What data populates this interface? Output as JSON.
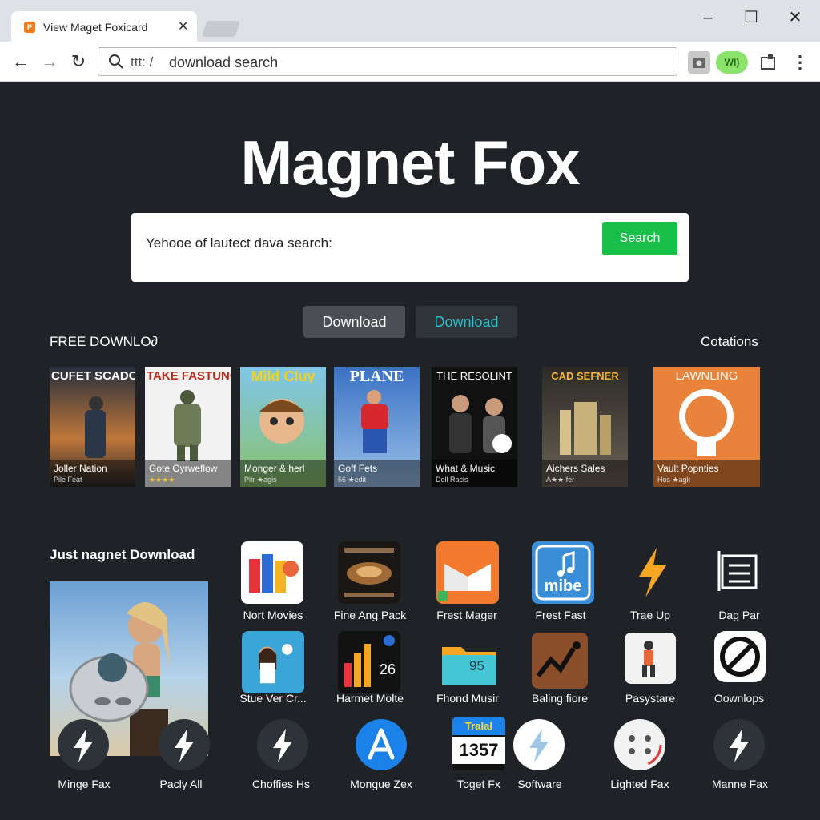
{
  "browser": {
    "tab_title": "View Maget Foxicard",
    "tab_favicon": "P",
    "address_prefix": "ttt: /",
    "address_text": "download search",
    "extension_label": "WI)"
  },
  "page": {
    "title": "Magnet Fox",
    "search_text": "Yehooe of lautect dava search:",
    "search_button": "Search",
    "buttons": [
      "Download",
      "Download"
    ],
    "free_download_label": "FREE DOWNLO∂",
    "collections_label": "Cotations",
    "just_download_label": "Just nagnet Download"
  },
  "posters": [
    {
      "head": "CUFET SCADONS",
      "title": "Joller Nation",
      "sub": "Pile Feat"
    },
    {
      "head": "TAKE FASTUNCK",
      "title": "Gote Oyrweflow",
      "sub": "★★★★"
    },
    {
      "head": "Mild Cluy",
      "title": "Monger & herl",
      "sub": "Pitr ★agis"
    },
    {
      "head": "PLANE",
      "title": "Goff Fets",
      "sub": "56 ★edit"
    },
    {
      "head": "THE RESOLINT",
      "title": "What & Music",
      "sub": "Dell Racls"
    },
    {
      "head": "CAD SEFNER",
      "title": "Aichers Sales",
      "sub": "A★★ fer"
    },
    {
      "head": "LAWNLING",
      "title": "Vault Popnties",
      "sub": "Hos ★agk"
    }
  ],
  "apps_row1": [
    {
      "label": "Nort Movies",
      "icon": "nort-movies-icon"
    },
    {
      "label": "Fine Ang Pack",
      "icon": "fine-ang-pack-icon"
    },
    {
      "label": "Frest Mager",
      "icon": "frest-mager-icon"
    },
    {
      "label": "Frest Fast",
      "icon": "frest-fast-icon"
    },
    {
      "label": "Trae Up",
      "icon": "lightning-icon"
    },
    {
      "label": "Dag Par",
      "icon": "dag-par-icon"
    }
  ],
  "apps_row2": [
    {
      "label": "Stue Ver Cr...",
      "icon": "stue-ver-icon"
    },
    {
      "label": "Harmet Molte",
      "icon": "bar-chart-icon",
      "badge": "26"
    },
    {
      "label": "Fhond Musir",
      "icon": "folder-icon",
      "badge": "95"
    },
    {
      "label": "Baling fiore",
      "icon": "baling-fiore-icon"
    },
    {
      "label": "Pasystare",
      "icon": "pasystare-icon"
    },
    {
      "label": "Oownlops",
      "icon": "no-sign-icon"
    }
  ],
  "apps_row3": [
    {
      "label": "Minge Fax",
      "icon": "lightning-circle-icon"
    },
    {
      "label": "Pacly All",
      "icon": "lightning-circle-icon"
    },
    {
      "label": "Choffies Hs",
      "icon": "lightning-circle-icon"
    },
    {
      "label": "Mongue Zex",
      "icon": "app-store-icon"
    },
    {
      "label": "Toget Fx",
      "icon": "counter-icon",
      "badge_top": "Tralal",
      "badge_num": "1357"
    },
    {
      "label": "Software",
      "icon": "lightning-white-icon"
    },
    {
      "label": "Lighted Fax",
      "icon": "dots-circle-icon"
    },
    {
      "label": "Manne Fax",
      "icon": "lightning-circle-icon"
    }
  ],
  "colors": {
    "background": "#1f2226",
    "search_button": "#18c04a",
    "download_accent": "#29c0c9"
  }
}
